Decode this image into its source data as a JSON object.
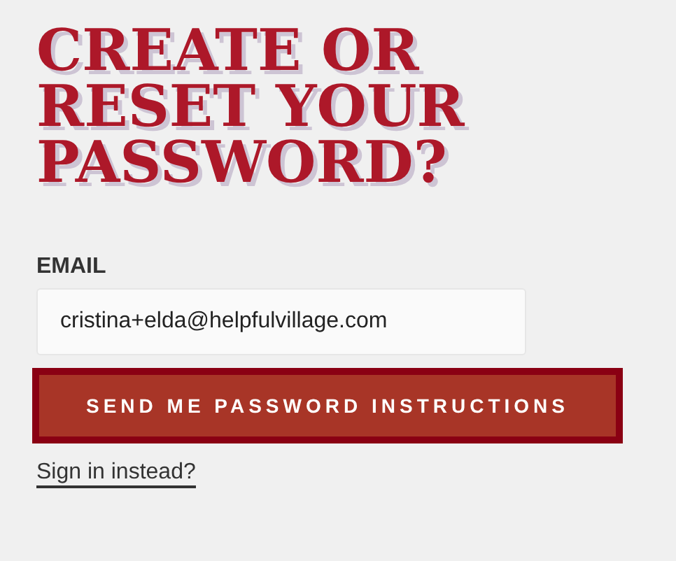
{
  "heading": [
    "CREATE OR",
    "RESET YOUR",
    "PASSWORD?"
  ],
  "email": {
    "label": "EMAIL",
    "value": "cristina+elda@helpfulvillage.com"
  },
  "submit_button": "SEND ME PASSWORD INSTRUCTIONS",
  "sign_in_link": "Sign in instead?"
}
